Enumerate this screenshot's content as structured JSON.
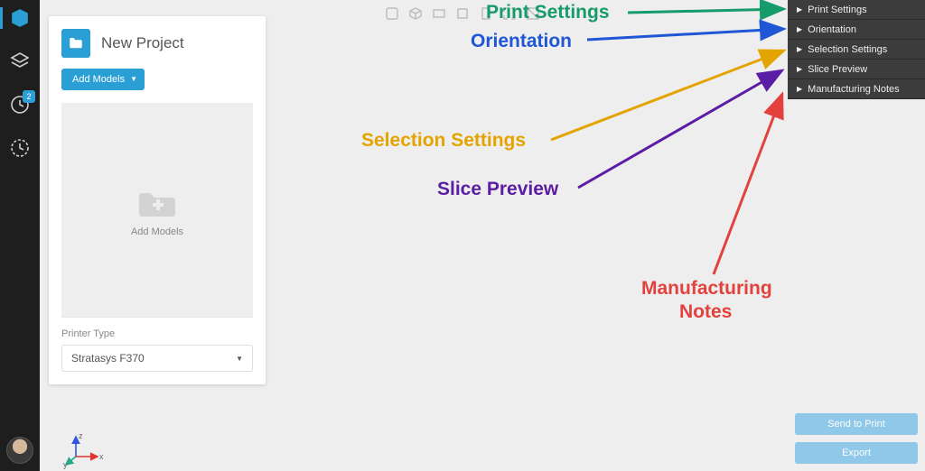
{
  "sidebar": {
    "items": [
      {
        "name": "build-icon"
      },
      {
        "name": "layers-icon"
      },
      {
        "name": "history-icon",
        "badge": "2"
      },
      {
        "name": "recent-icon"
      }
    ]
  },
  "panel": {
    "title": "New Project",
    "add_models_btn": "Add Models",
    "drop_caption": "Add Models",
    "printer_label": "Printer Type",
    "printer_selected": "Stratasys F370"
  },
  "accordion": {
    "items": [
      "Print Settings",
      "Orientation",
      "Selection Settings",
      "Slice Preview",
      "Manufacturing Notes"
    ]
  },
  "buttons": {
    "send": "Send to Print",
    "export": "Export"
  },
  "annotations": {
    "print_settings": {
      "label": "Print Settings",
      "color": "#169b6b"
    },
    "orientation": {
      "label": "Orientation",
      "color": "#1f56d6"
    },
    "selection_settings": {
      "label": "Selection Settings",
      "color": "#e4a400"
    },
    "slice_preview": {
      "label": "Slice Preview",
      "color": "#5b1da5"
    },
    "manufacturing": {
      "label1": "Manufacturing",
      "label2": "Notes",
      "color": "#e2413d"
    }
  },
  "axes": {
    "x": "x",
    "y": "y",
    "z": "z"
  }
}
